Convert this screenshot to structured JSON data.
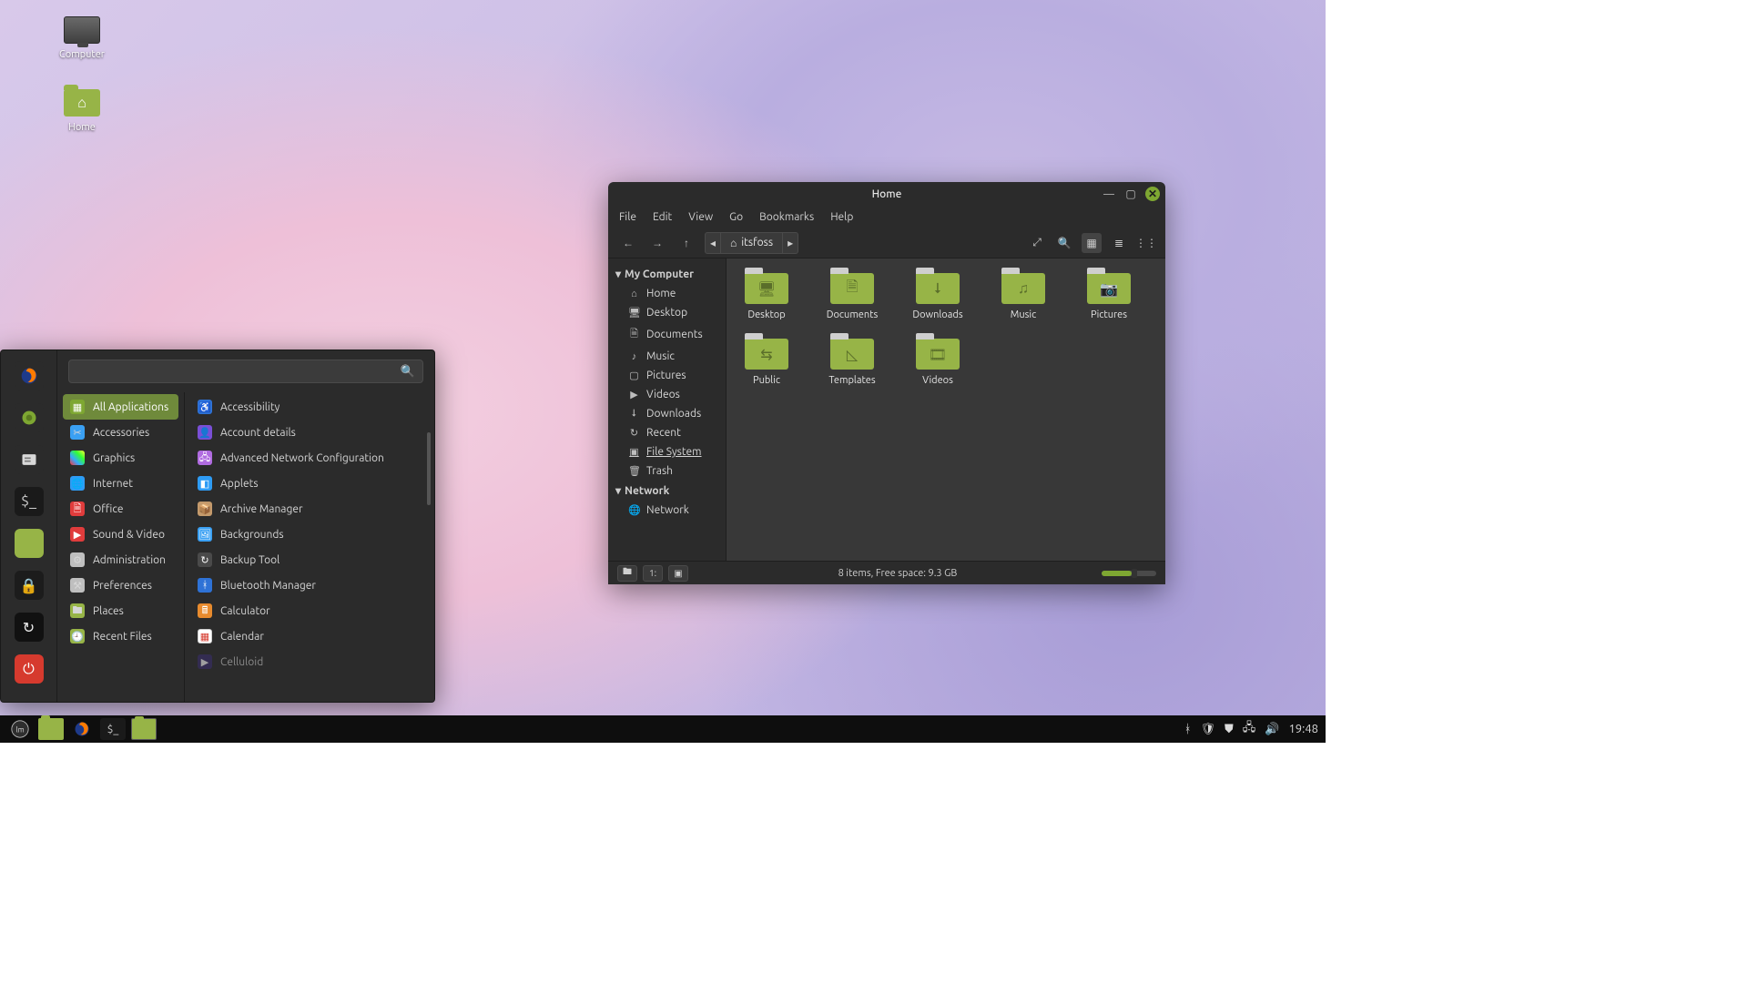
{
  "desktop_icons": {
    "computer": "Computer",
    "home": "Home"
  },
  "fm": {
    "title": "Home",
    "menu": {
      "file": "File",
      "edit": "Edit",
      "view": "View",
      "go": "Go",
      "bookmarks": "Bookmarks",
      "help": "Help"
    },
    "crumb": "itsfoss",
    "sidebar": {
      "my_computer": "My Computer",
      "items": {
        "home": "Home",
        "desktop": "Desktop",
        "documents": "Documents",
        "music": "Music",
        "pictures": "Pictures",
        "videos": "Videos",
        "downloads": "Downloads",
        "recent": "Recent",
        "file_system": "File System",
        "trash": "Trash"
      },
      "network_header": "Network",
      "network": "Network"
    },
    "folders": {
      "desktop": "Desktop",
      "documents": "Documents",
      "downloads": "Downloads",
      "music": "Music",
      "pictures": "Pictures",
      "public": "Public",
      "templates": "Templates",
      "videos": "Videos"
    },
    "status": "8 items, Free space: 9.3 GB"
  },
  "startmenu": {
    "search_placeholder": "",
    "categories": {
      "all_applications": "All Applications",
      "accessories": "Accessories",
      "graphics": "Graphics",
      "internet": "Internet",
      "office": "Office",
      "sound_video": "Sound & Video",
      "administration": "Administration",
      "preferences": "Preferences",
      "places": "Places",
      "recent_files": "Recent Files"
    },
    "apps": {
      "accessibility": "Accessibility",
      "account_details": "Account details",
      "advanced_network": "Advanced Network Configuration",
      "applets": "Applets",
      "archive_manager": "Archive Manager",
      "backgrounds": "Backgrounds",
      "backup_tool": "Backup Tool",
      "bluetooth_manager": "Bluetooth Manager",
      "calculator": "Calculator",
      "calendar": "Calendar",
      "celluloid": "Celluloid"
    }
  },
  "taskbar": {
    "clock": "19:48"
  }
}
